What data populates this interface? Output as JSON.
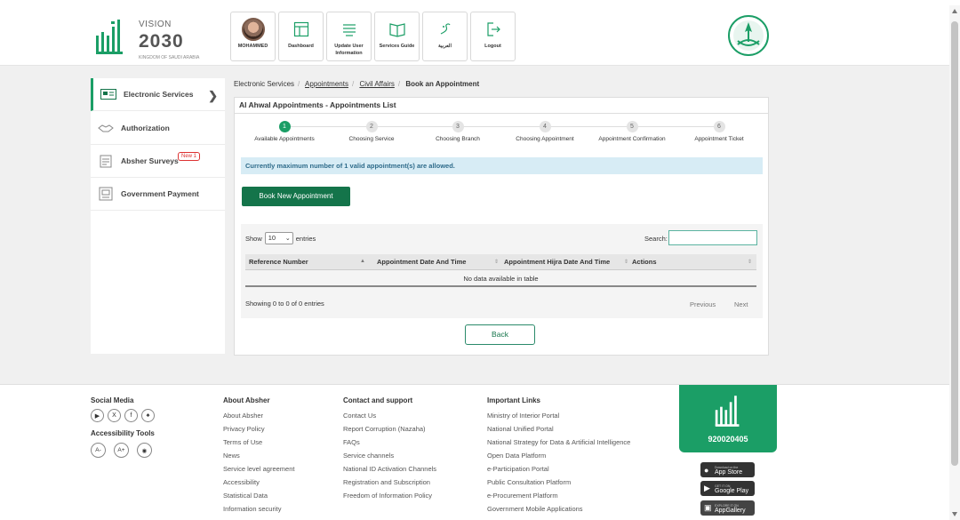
{
  "header": {
    "logo_vision": "VISION",
    "logo_year": "2030",
    "logo_ksa": "KINGDOM OF SAUDI ARABIA",
    "nav": [
      {
        "label": "MOHAMMED",
        "icon": "user-avatar"
      },
      {
        "label": "Dashboard",
        "icon": "dashboard-icon"
      },
      {
        "label": "Update User Information",
        "icon": "user-info-icon"
      },
      {
        "label": "Services Guide",
        "icon": "book-icon"
      },
      {
        "label": "العربية",
        "icon": "arabic-language-icon"
      },
      {
        "label": "Logout",
        "icon": "logout-icon"
      }
    ]
  },
  "sidebar": {
    "items": [
      {
        "label": "Electronic Services",
        "icon": "electronic-services-icon",
        "active": true
      },
      {
        "label": "Authorization",
        "icon": "handshake-icon"
      },
      {
        "label": "Absher Surveys",
        "icon": "survey-icon",
        "badge": "New 1"
      },
      {
        "label": "Government Payment",
        "icon": "payment-icon"
      }
    ]
  },
  "breadcrumb": {
    "items": [
      "Electronic Services",
      "Appointments",
      "Civil Affairs"
    ],
    "current": "Book an Appointment"
  },
  "panel": {
    "title": "Al Ahwal Appointments - Appointments List",
    "steps": [
      {
        "num": "1",
        "label": "Available Appointments",
        "active": true
      },
      {
        "num": "2",
        "label": "Choosing Service"
      },
      {
        "num": "3",
        "label": "Choosing Branch"
      },
      {
        "num": "4",
        "label": "Choosing Appointment"
      },
      {
        "num": "5",
        "label": "Appointment Confirmation"
      },
      {
        "num": "6",
        "label": "Appointment Ticket"
      }
    ],
    "alert": "Currently maximum number of 1 valid appointment(s) are allowed.",
    "book_button": "Book New Appointment",
    "table": {
      "show_label": "Show",
      "entries_value": "10",
      "entries_label": "entries",
      "search_label": "Search:",
      "search_value": "",
      "columns": [
        "Reference Number",
        "Appointment Date And Time",
        "Appointment Hijra Date And Time",
        "Actions"
      ],
      "empty": "No data available in table",
      "info": "Showing 0 to 0 of 0 entries",
      "previous": "Previous",
      "next": "Next"
    },
    "back_button": "Back"
  },
  "footer": {
    "social_media": "Social Media",
    "social_icons": [
      "youtube-icon",
      "x-icon",
      "facebook-icon",
      "snapchat-icon"
    ],
    "accessibility_tools": "Accessibility Tools",
    "accessibility_buttons": [
      "A-",
      "A+",
      "view-icon"
    ],
    "about": {
      "title": "About Absher",
      "links": [
        "About Absher",
        "Privacy Policy",
        "Terms of Use",
        "News",
        "Service level agreement",
        "Accessibility",
        "Statistical Data",
        "Information security"
      ]
    },
    "contact": {
      "title": "Contact and support",
      "links": [
        "Contact Us",
        "Report Corruption (Nazaha)",
        "FAQs",
        "Service channels",
        "National ID Activation Channels",
        "Registration and Subscription",
        "Freedom of Information Policy"
      ]
    },
    "important": {
      "title": "Important Links",
      "links": [
        "Ministry of Interior Portal",
        "National Unified Portal",
        "National Strategy for Data & Artificial Intelligence",
        "Open Data Platform",
        "e-Participation Portal",
        "Public Consultation Platform",
        "e-Procurement Platform",
        "Government Mobile Applications"
      ]
    },
    "phone": "920020405",
    "stores": [
      {
        "small": "Download on the",
        "big": "App Store",
        "icon": "apple-icon"
      },
      {
        "small": "GET IT ON",
        "big": "Google Play",
        "icon": "google-play-icon"
      },
      {
        "small": "EXPLORE IT ON",
        "big": "AppGallery",
        "icon": "appgallery-icon"
      }
    ]
  },
  "colors": {
    "primary_green": "#1b9e66",
    "dark_green": "#14744a",
    "alert_bg": "#d7ecf5",
    "alert_text": "#2e6b8a"
  }
}
